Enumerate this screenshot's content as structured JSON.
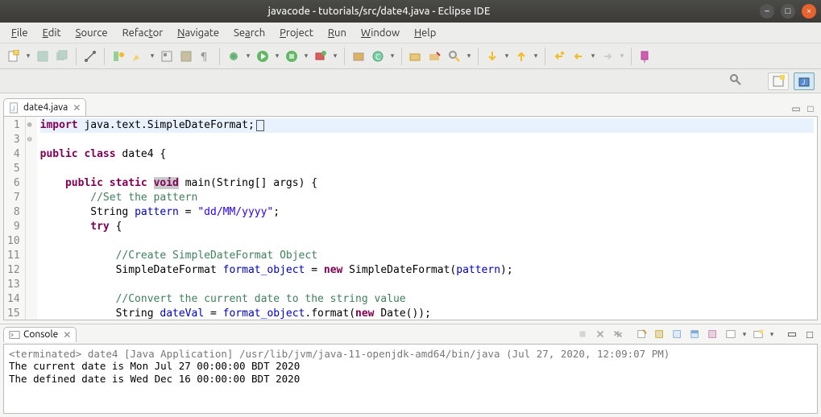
{
  "window": {
    "title": "javacode - tutorials/src/date4.java - Eclipse IDE"
  },
  "menubar": [
    "File",
    "Edit",
    "Source",
    "Refactor",
    "Navigate",
    "Search",
    "Project",
    "Run",
    "Window",
    "Help"
  ],
  "menu_underline": {
    "File": 0,
    "Edit": 0,
    "Source": 0,
    "Refactor": 5,
    "Navigate": 0,
    "Search": 2,
    "Project": 0,
    "Run": 0,
    "Window": 0,
    "Help": 0
  },
  "editor": {
    "tab": {
      "filename": "date4.java"
    },
    "lines": [
      {
        "n": "1",
        "fold": "⊕",
        "html": "<span class='kw'>import</span> java.text.SimpleDateFormat;<span class='cursor-box'></span>"
      },
      {
        "n": "3",
        "fold": "",
        "html": ""
      },
      {
        "n": "4",
        "fold": "",
        "html": "<span class='kw'>public</span> <span class='kw'>class</span> date4 {"
      },
      {
        "n": "5",
        "fold": "",
        "html": ""
      },
      {
        "n": "6",
        "fold": "⊖",
        "html": "    <span class='kw'>public</span> <span class='kw'>static</span> <span class='kw'><span class='sel'>void</span></span> main(String[] args) {"
      },
      {
        "n": "7",
        "fold": "",
        "html": "        <span class='cm'>//Set the pattern</span>"
      },
      {
        "n": "8",
        "fold": "",
        "html": "        String <span class='fld'>pattern</span> = <span class='str'>\"dd/MM/yyyy\"</span>;"
      },
      {
        "n": "9",
        "fold": "",
        "html": "        <span class='kw'>try</span> {"
      },
      {
        "n": "10",
        "fold": "",
        "html": ""
      },
      {
        "n": "11",
        "fold": "",
        "html": "            <span class='cm'>//Create SimpleDateFormat Object</span>"
      },
      {
        "n": "12",
        "fold": "",
        "html": "            SimpleDateFormat <span class='fld'>format_object</span> = <span class='kw'>new</span> SimpleDateFormat(<span class='fld'>pattern</span>);"
      },
      {
        "n": "13",
        "fold": "",
        "html": ""
      },
      {
        "n": "14",
        "fold": "",
        "html": "            <span class='cm'>//Convert the current date to the string value</span>"
      },
      {
        "n": "15",
        "fold": "",
        "html": "            String <span class='fld'>dateVal</span> = <span class='fld'>format_object</span>.format(<span class='kw'>new</span> Date());"
      }
    ]
  },
  "console": {
    "title": "Console",
    "terminated": "<terminated> date4 [Java Application] /usr/lib/jvm/java-11-openjdk-amd64/bin/java (Jul 27, 2020, 12:09:07 PM)",
    "out1": "The current date is Mon Jul 27 00:00:00 BDT 2020",
    "out2": "The defined date is Wed Dec 16 00:00:00 BDT 2020"
  }
}
